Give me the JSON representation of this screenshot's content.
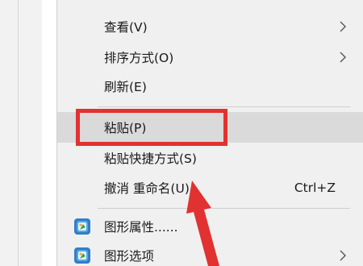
{
  "menu": {
    "items": [
      {
        "label": "查看(V)",
        "shortcut": "",
        "has_submenu": true,
        "icon": ""
      },
      {
        "label": "排序方式(O)",
        "shortcut": "",
        "has_submenu": true,
        "icon": ""
      },
      {
        "label": "刷新(E)",
        "shortcut": "",
        "has_submenu": false,
        "icon": ""
      },
      {
        "label": "粘贴(P)",
        "shortcut": "",
        "has_submenu": false,
        "icon": "",
        "highlighted": true
      },
      {
        "label": "粘贴快捷方式(S)",
        "shortcut": "",
        "has_submenu": false,
        "icon": ""
      },
      {
        "label": "撤消 重命名(U)",
        "shortcut": "Ctrl+Z",
        "has_submenu": false,
        "icon": ""
      },
      {
        "label": "图形属性......",
        "shortcut": "",
        "has_submenu": false,
        "icon": "intel-graphics-icon"
      },
      {
        "label": "图形选项",
        "shortcut": "",
        "has_submenu": true,
        "icon": "intel-graphics-icon"
      }
    ],
    "submenu_icon": "chevron-right-icon"
  },
  "annotation": {
    "color": "#e23131",
    "box_target": "粘贴(P)",
    "arrow_icon": "red-arrow-icon"
  }
}
